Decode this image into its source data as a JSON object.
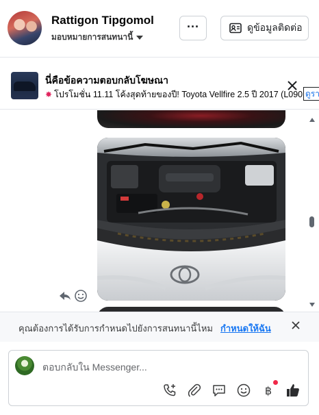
{
  "header": {
    "name": "Rattigon Tipgomol",
    "subtitle": "มอบหมายการสนทนานี้",
    "more_label": "···",
    "contact_label": "ดูข้อมูลติดต่อ"
  },
  "ad": {
    "title": "นี่คือข้อความตอบกลับโฆษณา",
    "text": "โปรโมชั่น 11.11 โค้งสุดท้ายของปี! Toyota Vellfire 2.5 ปี 2017 (L090) ...",
    "more_label": "ดูรา"
  },
  "prompt": {
    "text": "คุณต้องการได้รับการกำหนดไปยังการสนทนานี้ไหม",
    "link": "กำหนดให้ฉัน"
  },
  "composer": {
    "placeholder": "ตอบกลับใน Messenger..."
  },
  "colors": {
    "accent": "#1877f2",
    "badge": "#f02849"
  }
}
